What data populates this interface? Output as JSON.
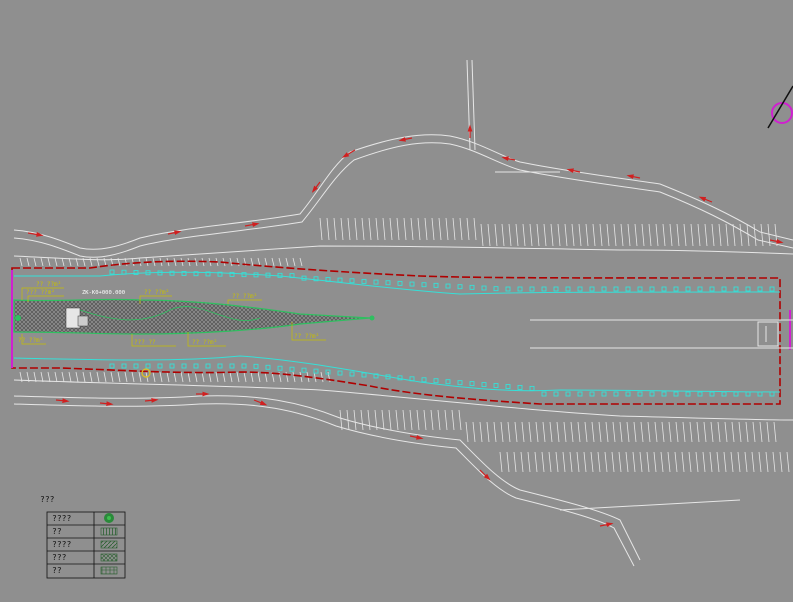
{
  "drawing": {
    "code_label": "ZK-K0+000.000",
    "area_labels": [
      "??  ??m²",
      "???  ??m²",
      "??  ??m²",
      "??  ??m²",
      "??  ??m²",
      "???  ??",
      "??  ??m²",
      "??  ??m²",
      "??  ??m²"
    ]
  },
  "legend": {
    "title": "???",
    "rows": [
      {
        "label": "????",
        "swatch": "tree"
      },
      {
        "label": "??",
        "swatch": "hatch-vertical"
      },
      {
        "label": "????",
        "swatch": "hatch-diagonal"
      },
      {
        "label": "???",
        "swatch": "hatch-cross"
      },
      {
        "label": "??",
        "swatch": "hatch-grid"
      }
    ]
  },
  "colors": {
    "background": "#8f8f8f",
    "road_lines": "#e6e6e6",
    "boundary": "#b00000",
    "planting_edge": "#35e0d8",
    "island_edge": "#2fbf60",
    "label": "#c8c000",
    "marker": "#d020d0"
  }
}
